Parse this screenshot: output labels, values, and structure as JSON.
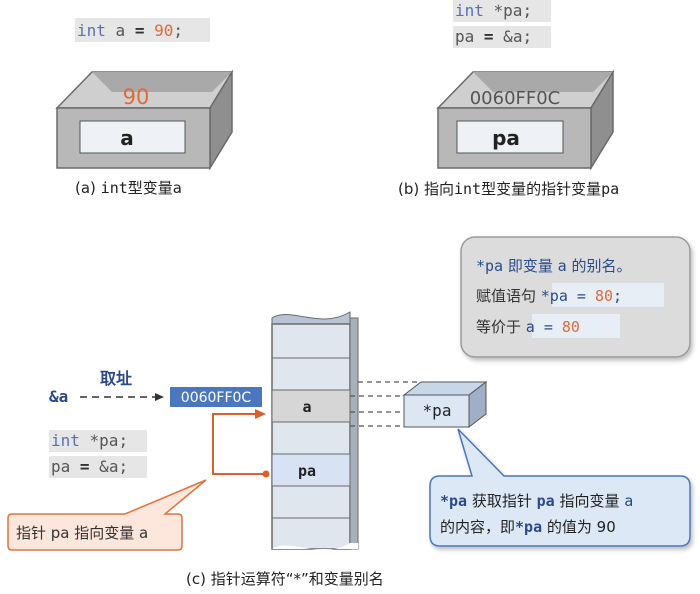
{
  "panel_a": {
    "code": {
      "kw": "int",
      "rest_pre": " a ",
      "op": "=",
      "sp": " ",
      "num": "90",
      "semi": ";"
    },
    "box_value": "90",
    "box_label": "a",
    "caption_pre": "(a) ",
    "caption_code": "int",
    "caption_post": "型变量a"
  },
  "panel_b": {
    "line1": {
      "kw": "int",
      "rest": " *pa;"
    },
    "line2": {
      "pre": "pa ",
      "op": "=",
      "post": " &a;"
    },
    "box_value": "0060FF0C",
    "box_label": "pa",
    "caption_pre": "(b) 指向",
    "caption_code": "int",
    "caption_mid": "型变量的指针变量",
    "caption_post": "pa"
  },
  "panel_c": {
    "amp_a": "&a",
    "fetch_label": "取址",
    "address": "0060FF0C",
    "code_line1": {
      "kw": "int",
      "rest": " *pa;"
    },
    "code_line2": {
      "pre": "pa ",
      "op": "=",
      "post": " &a;"
    },
    "cell_a": "a",
    "cell_pa": "pa",
    "deref_box": "*pa",
    "pointer_note": "指针 pa 指向变量 a",
    "info_box": {
      "line1_a": "*pa",
      "line1_b": " 即变量 ",
      "line1_c": "a",
      "line1_d": " 的别名。",
      "line2_a": "赋值语句 ",
      "line2_b": "*pa = ",
      "line2_c": "80",
      "line2_d": ";",
      "line3_a": "等价于 ",
      "line3_b": "a = ",
      "line3_c": "80"
    },
    "callout": {
      "l1_a": "*pa",
      "l1_b": " 获取指针 ",
      "l1_c": "pa",
      "l1_d": " 指向变量 ",
      "l1_e": "a",
      "l2_a": "的内容，即",
      "l2_b": "*pa",
      "l2_c": " 的值为 90"
    },
    "caption": "(c) 指针运算符“*”和变量别名"
  },
  "colors": {
    "keyword": "#5b6fb5",
    "number": "#e06a3a",
    "code_bg": "#e6e6e6",
    "address_bg": "#4a78c0",
    "callout_bg": "#dde8f6",
    "callout_border": "#4a76bf",
    "note_bg": "#fde6dc",
    "note_border": "#e0733b",
    "info_bg": "#dcdcdc",
    "cell_a_bg": "#d6d6d6",
    "cell_pa_bg": "#d7e3f4"
  }
}
